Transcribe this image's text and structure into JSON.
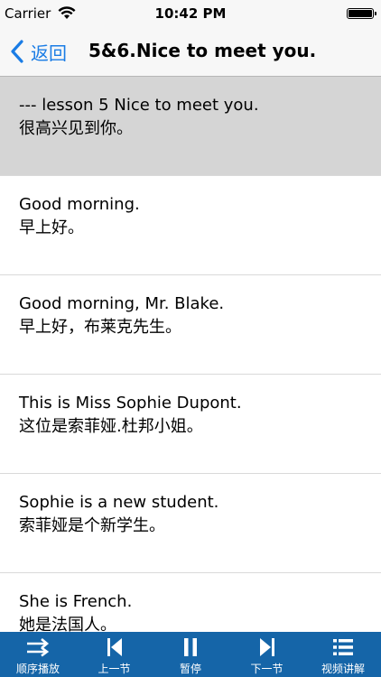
{
  "status_bar": {
    "carrier": "Carrier",
    "time": "10:42 PM"
  },
  "navbar": {
    "back_label": "返回",
    "title": "5&6.Nice to meet you."
  },
  "rows": [
    {
      "en": "--- lesson 5  Nice to meet you.",
      "cn": "很高兴见到你。"
    },
    {
      "en": "Good morning.",
      "cn": "早上好。"
    },
    {
      "en": "Good morning, Mr. Blake.",
      "cn": "早上好，布莱克先生。"
    },
    {
      "en": "This is Miss Sophie Dupont.",
      "cn": "这位是索菲娅.杜邦小姐。"
    },
    {
      "en": "Sophie is a new student.",
      "cn": "索菲娅是个新学生。"
    },
    {
      "en": "She is French.",
      "cn": "她是法国人。"
    }
  ],
  "toolbar": {
    "items": [
      {
        "label": "顺序播放",
        "icon": "repeat-arrows-icon"
      },
      {
        "label": "上一节",
        "icon": "previous-track-icon"
      },
      {
        "label": "暂停",
        "icon": "pause-icon"
      },
      {
        "label": "下一节",
        "icon": "next-track-icon"
      },
      {
        "label": "视频讲解",
        "icon": "list-icon"
      }
    ]
  },
  "colors": {
    "accent": "#1a7ce5",
    "toolbar_bg": "#1565a8",
    "header_row_bg": "#d5d5d5"
  }
}
